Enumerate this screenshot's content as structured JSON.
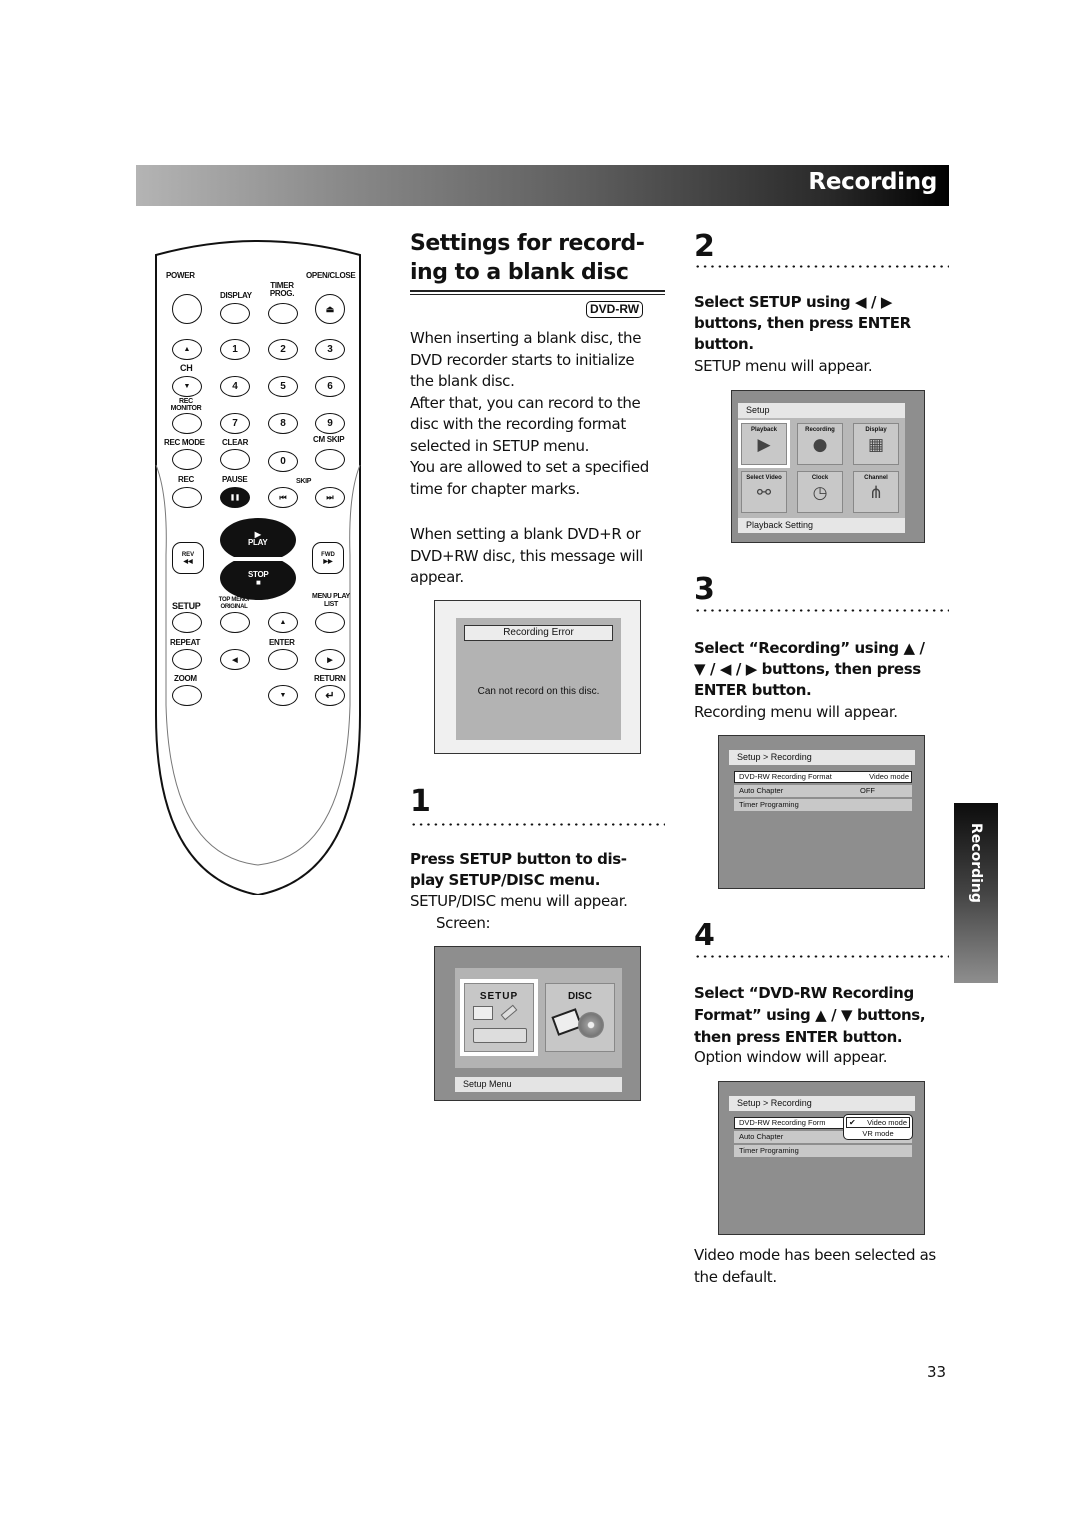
{
  "header": {
    "title": "Recording"
  },
  "side_tab": {
    "label": "Recording"
  },
  "remote": {
    "labels": {
      "power": "POWER",
      "display": "DISPLAY",
      "timer_prog": "TIMER PROG.",
      "open_close": "OPEN/CLOSE",
      "ch": "CH",
      "rec_monitor": "REC MONITOR",
      "rec_mode": "REC MODE",
      "clear": "CLEAR",
      "cm_skip": "CM SKIP",
      "rec": "REC",
      "pause": "PAUSE",
      "skip": "SKIP",
      "play": "PLAY",
      "stop": "STOP",
      "rev": "REV",
      "fwd": "FWD",
      "setup": "SETUP",
      "top_menu": "TOP MENU/ ORIGINAL",
      "menu": "MENU PLAY LIST",
      "repeat": "REPEAT",
      "enter": "ENTER",
      "zoom": "ZOOM",
      "return": "RETURN"
    },
    "digits": [
      "1",
      "2",
      "3",
      "4",
      "5",
      "6",
      "7",
      "8",
      "9",
      "0"
    ],
    "glyphs": {
      "eject": "⏏",
      "up": "▲",
      "down": "▼",
      "left": "◀",
      "right": "▶",
      "pause": "❚❚",
      "prev": "⏮",
      "next": "⏭",
      "rev": "◀◀",
      "fwd": "▶▶",
      "play": "▶",
      "stop": "■",
      "return": "↵"
    }
  },
  "left": {
    "title_line1": "Settings for record-",
    "title_line2": "ing to a blank disc",
    "disc_badge": "DVD-RW",
    "intro": [
      "When inserting a blank disc, the",
      "DVD recorder starts to initialize",
      "the blank disc.",
      "After that, you can record to the",
      "disc with the recording format",
      "selected in SETUP menu.",
      "You are allowed to set a specified",
      "time for chapter marks."
    ],
    "note": [
      "When setting a blank DVD+R or",
      "DVD+RW disc, this message will",
      "appear."
    ],
    "error_screen": {
      "title": "Recording Error",
      "message": "Can not record on this disc."
    },
    "step1": {
      "number": "1",
      "instruction_line1": "Press SETUP button to dis-",
      "instruction_line2": "play SETUP/DISC menu.",
      "result": "SETUP/DISC menu will appear.",
      "screen_label": "Screen:"
    },
    "setup_disc_screen": {
      "setup_label": "SETUP",
      "disc_label": "DISC",
      "status": "Setup Menu"
    }
  },
  "right": {
    "step2": {
      "number": "2",
      "instruction": [
        "Select SETUP using ◀ / ▶",
        "buttons, then press ENTER",
        "button."
      ],
      "result": "SETUP menu will appear.",
      "screen": {
        "title": "Setup",
        "items": [
          "Playback",
          "Recording",
          "Display",
          "Select Video",
          "Clock",
          "Channel"
        ],
        "status": "Playback Setting"
      }
    },
    "step3": {
      "number": "3",
      "instruction": [
        "Select “Recording” using ▲ /",
        "▼ / ◀ / ▶ buttons, then press",
        "ENTER button."
      ],
      "result": "Recording menu will appear.",
      "screen": {
        "title": "Setup > Recording",
        "rows": [
          {
            "label": "DVD-RW Recording Format",
            "value": "Video mode"
          },
          {
            "label": "Auto Chapter",
            "value": "OFF"
          },
          {
            "label": "Timer Programing",
            "value": ""
          }
        ]
      }
    },
    "step4": {
      "number": "4",
      "instruction": [
        "Select “DVD-RW Recording",
        "Format” using ▲ / ▼ buttons,",
        "then press ENTER button."
      ],
      "result": "Option window will appear.",
      "screen": {
        "title": "Setup > Recording",
        "rows": [
          {
            "label": "DVD-RW Recording Form"
          },
          {
            "label": "Auto Chapter"
          },
          {
            "label": "Timer Programing"
          }
        ],
        "options": [
          {
            "label": "Video mode",
            "checked": "✔"
          },
          {
            "label": "VR mode",
            "checked": ""
          }
        ]
      },
      "footnote": [
        "Video mode has been selected as",
        "the default."
      ]
    }
  },
  "page_number": "33"
}
